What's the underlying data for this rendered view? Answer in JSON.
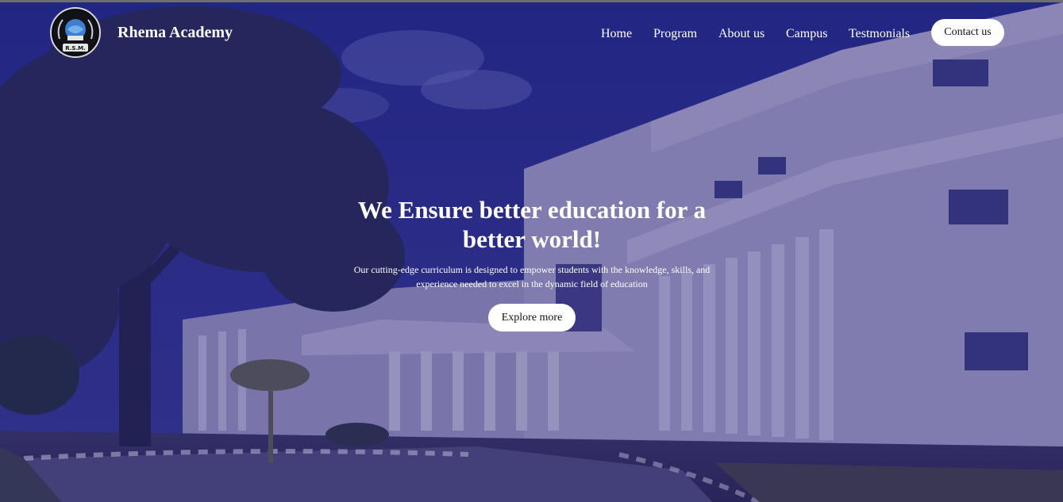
{
  "brand": {
    "name": "Rhema Academy",
    "logo_text": "R.S.M."
  },
  "nav": {
    "items": [
      {
        "label": "Home"
      },
      {
        "label": "Program"
      },
      {
        "label": "About us"
      },
      {
        "label": "Campus"
      },
      {
        "label": "Testmonials"
      }
    ],
    "contact_label": "Contact us"
  },
  "hero": {
    "title": "We Ensure better education for a better world!",
    "subtitle": "Our cutting-edge curriculum is designed to empower students with the knowledge, skills, and experience needed to excel in the dynamic field of education",
    "cta_label": "Explore more",
    "background_image": "campus-building-with-tree"
  },
  "colors": {
    "overlay": "#2b2a78",
    "button_bg": "#ffffff",
    "text": "#ffffff"
  }
}
